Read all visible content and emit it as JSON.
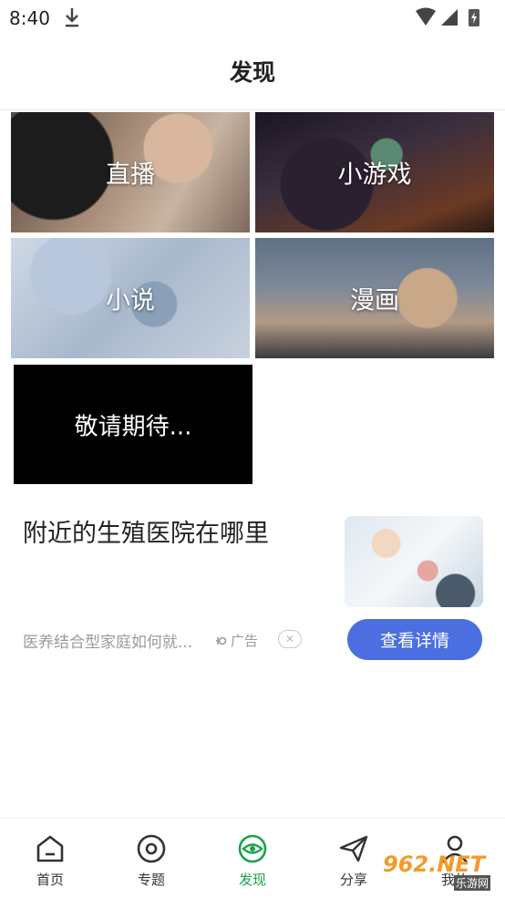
{
  "status": {
    "time": "8:40"
  },
  "header": {
    "title": "发现"
  },
  "tiles": [
    {
      "label": "直播"
    },
    {
      "label": "小游戏"
    },
    {
      "label": "小说"
    },
    {
      "label": "漫画"
    },
    {
      "label": "敬请期待..."
    }
  ],
  "ad": {
    "title": "附近的生殖医院在哪里",
    "description": "医养结合型家庭如何就...",
    "tag": "广告",
    "button": "查看详情",
    "button_color": "#4b6fe0"
  },
  "tabbar": {
    "active_color": "#1aa34a",
    "items": [
      {
        "label": "首页",
        "icon": "home-icon"
      },
      {
        "label": "专题",
        "icon": "target-icon"
      },
      {
        "label": "发现",
        "icon": "eye-icon"
      },
      {
        "label": "分享",
        "icon": "paper-plane-icon"
      },
      {
        "label": "我的",
        "icon": "user-icon"
      }
    ]
  },
  "watermark": {
    "brand": "962.NET",
    "sub": "乐游网"
  }
}
